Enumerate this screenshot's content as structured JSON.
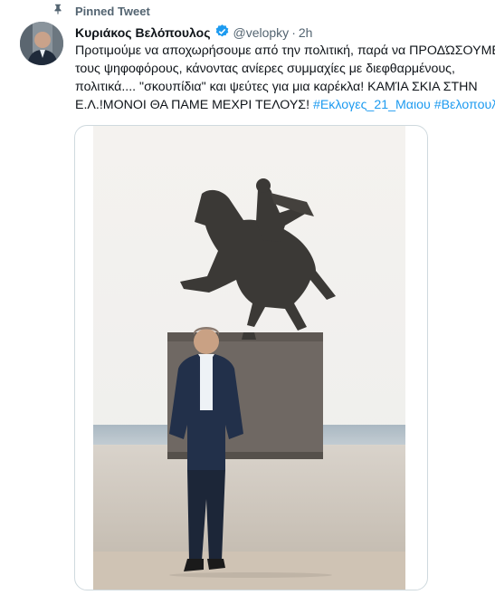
{
  "pinned": {
    "label": "Pinned Tweet",
    "icon": "pin-icon"
  },
  "author": {
    "name": "Κυριάκος Βελόπουλος",
    "verified_icon": "verified-badge-icon",
    "handle": "@velopky",
    "separator": "·",
    "time": "2h"
  },
  "tweet": {
    "line1": "Προτιμούμε να αποχωρήσουμε από την πολιτική, παρά να ΠΡΟΔΏΣΟΥΜΕ",
    "line2": "τους ψηφοφόρους, κάνοντας ανίερες συμμαχίες με διεφθαρμένους,",
    "line3": "πολιτικά.... \"σκουπίδια\" και ψεύτες για μια καρέκλα! ΚΑΜΊΑ ΣΚΙΑ ΣΤΗΝ",
    "line4_text": "Ε.Λ.!ΜΟΝΟΙ ΘΑ ΠΑΜΕ ΜΕΧΡΙ ΤΕΛΟΥΣ! ",
    "hashtag1": "#Εκλογες_21_Μαιου",
    "hashtag2": "#Βελοπουλος"
  },
  "colors": {
    "link": "#1d9bf0",
    "secondary": "#536471",
    "verified": "#1d9bf0"
  }
}
